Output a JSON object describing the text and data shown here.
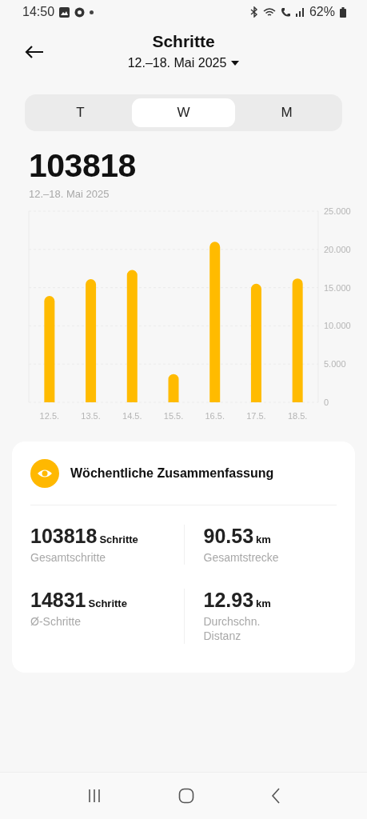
{
  "status_bar": {
    "time": "14:50",
    "battery": "62%"
  },
  "header": {
    "title": "Schritte",
    "date_range": "12.–18. Mai 2025"
  },
  "tabs": [
    {
      "label": "T",
      "selected": false
    },
    {
      "label": "W",
      "selected": true
    },
    {
      "label": "M",
      "selected": false
    }
  ],
  "total": {
    "value": "103818",
    "date": "12.–18. Mai 2025"
  },
  "chart_data": {
    "type": "bar",
    "categories": [
      "12.5.",
      "13.5.",
      "14.5.",
      "15.5.",
      "16.5.",
      "17.5.",
      "18.5."
    ],
    "series": [
      {
        "color": "#ffbb00",
        "values": [
          13.9,
          16.1,
          17.3,
          3.7,
          21.0,
          15.5,
          16.2
        ]
      }
    ],
    "ylim": [
      0,
      25
    ],
    "grid": true,
    "yticks": [
      {
        "value": 0,
        "label": "0"
      },
      {
        "value": 5,
        "label": "5.000"
      },
      {
        "value": 10,
        "label": "10.000"
      },
      {
        "value": 15,
        "label": "15.000"
      },
      {
        "value": 20,
        "label": "20.000"
      },
      {
        "value": 25,
        "label": "25.000"
      }
    ]
  },
  "summary": {
    "title": "Wöchentliche Zusammenfassung",
    "stats": [
      {
        "value": "103818",
        "unit": "Schritte",
        "label": "Gesamtschritte"
      },
      {
        "value": "90.53",
        "unit": "km",
        "label": "Gesamtstrecke"
      },
      {
        "value": "14831",
        "unit": "Schritte",
        "label": "Ø-Schritte"
      },
      {
        "value": "12.93",
        "unit": "km",
        "label": "Durchschn. Distanz"
      }
    ]
  }
}
